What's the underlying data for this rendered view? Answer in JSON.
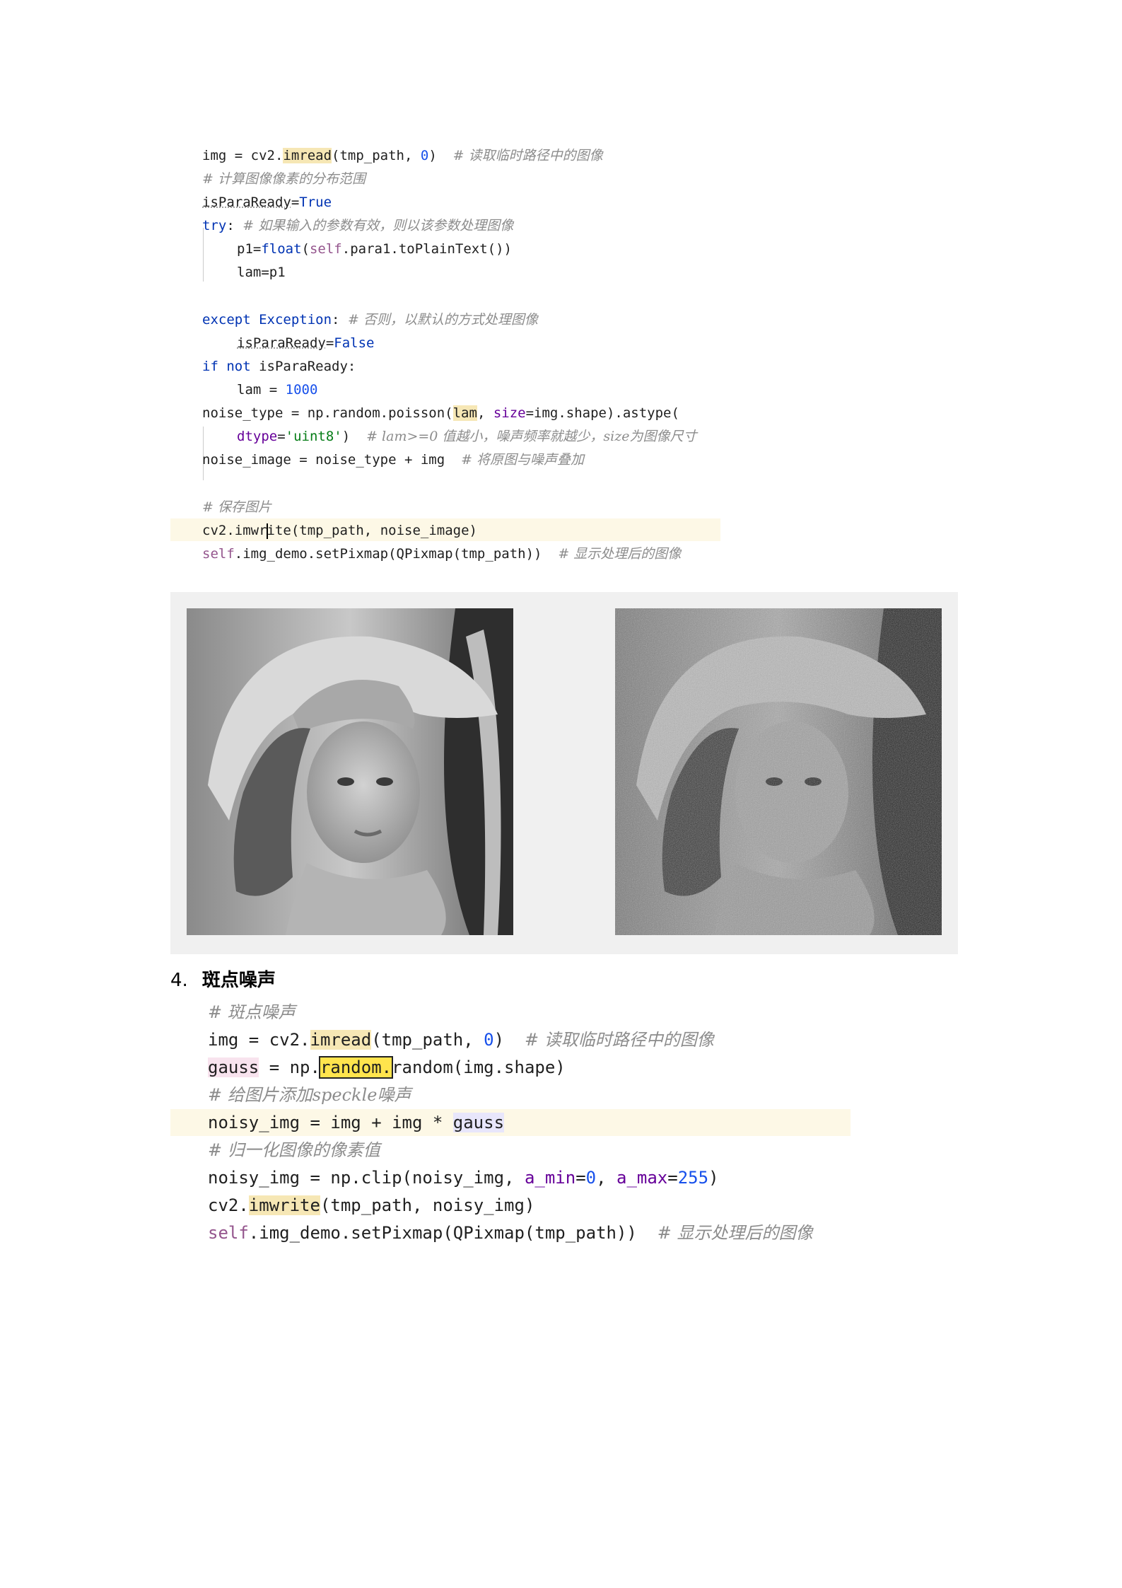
{
  "code_block_1": {
    "lines": [
      {
        "code": "img = cv2.",
        "fn": "imread",
        "rest": "(tmp_path, ",
        "num": "0",
        "close": ")",
        "comment": "# 读取临时路径中的图像"
      },
      {
        "comment": "# 计算图像像素的分布范围"
      },
      {
        "var": "isParaReady",
        "op": "=",
        "val": "True"
      },
      {
        "kw": "try",
        "colon": ":",
        "comment": "# 如果输入的参数有效，则以该参数处理图像"
      },
      {
        "lhs": "p1=",
        "fn": "float",
        "open": "(",
        "self": "self",
        "rest": ".para1.toPlainText())"
      },
      {
        "text": "lam=p1"
      },
      {
        "kw": "except",
        "cls": "Exception",
        "colon": ":",
        "comment": "# 否则，以默认的方式处理图像"
      },
      {
        "var": "isParaReady",
        "op": "=",
        "val": "False"
      },
      {
        "kw": "if not",
        "text": " isParaReady:"
      },
      {
        "text": "lam = ",
        "num": "1000"
      },
      {
        "text": "noise_type = np.random.poisson(",
        "hl": "lam",
        "sep": ", ",
        "param": "size",
        "rest": "=img.shape).astype("
      },
      {
        "param": "dtype",
        "eq": "=",
        "str": "'uint8'",
        "close": ")",
        "comment": "# lam>=0 值越小，噪声频率就越少，size为图像尺寸"
      },
      {
        "text": "noise_image = noise_type + img",
        "comment": "# 将原图与噪声叠加"
      },
      {
        "comment": "# 保存图片"
      },
      {
        "pre": "cv2.",
        "fn_a": "imwr",
        "fn_b": "ite",
        "rest": "(tmp_path, noise_image)"
      },
      {
        "self": "self",
        "rest": ".img_demo.setPixmap(QPixmap(tmp_path))",
        "comment": "# 显示处理后的图像"
      }
    ]
  },
  "images": {
    "original": "lena-grayscale",
    "noisy": "lena-poisson-noise"
  },
  "section": {
    "number": "4.",
    "title": "斑点噪声"
  },
  "code_block_2": {
    "lines": [
      {
        "comment": "# 斑点噪声"
      },
      {
        "code": "img = cv2.",
        "fn": "imread",
        "rest": "(tmp_path, ",
        "num": "0",
        "close": ")",
        "comment": "# 读取临时路径中的图像"
      },
      {
        "var": "gauss",
        "mid": " = np.",
        "sel": "random.",
        "rest": "random(img.shape)"
      },
      {
        "comment": "# 给图片添加speckle噪声"
      },
      {
        "text": "noisy_img = img + img * ",
        "var": "gauss"
      },
      {
        "comment": "# 归一化图像的像素值"
      },
      {
        "text": "noisy_img = np.clip(noisy_img, ",
        "p1": "a_min",
        "v1": "0",
        "sep": ", ",
        "p2": "a_max",
        "v2": "255",
        "close": ")"
      },
      {
        "pre": "cv2.",
        "fn": "imwrite",
        "rest": "(tmp_path, noisy_img)"
      },
      {
        "self": "self",
        "rest": ".img_demo.setPixmap(QPixmap(tmp_path))",
        "comment": "# 显示处理后的图像"
      }
    ]
  }
}
